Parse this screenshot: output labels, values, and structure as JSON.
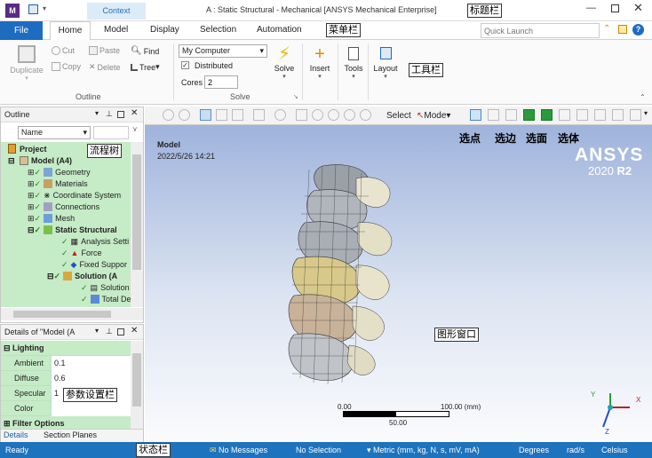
{
  "titlebar": {
    "context_tab": "Context",
    "title": "A : Static Structural - Mechanical [ANSYS Mechanical Enterprise]",
    "annotation": "标题栏"
  },
  "menubar": {
    "file": "File",
    "tabs": [
      "Home",
      "Model",
      "Display",
      "Selection",
      "Automation"
    ],
    "annotation": "菜单栏",
    "quick_launch_placeholder": "Quick Launch"
  },
  "ribbon": {
    "duplicate": "Duplicate",
    "cut": "Cut",
    "copy": "Copy",
    "paste": "Paste",
    "delete": "Delete",
    "find": "Find",
    "tree": "Tree",
    "outline_group": "Outline",
    "solver_target": "My Computer",
    "distributed": "Distributed",
    "cores_label": "Cores",
    "cores_value": "2",
    "solve": "Solve",
    "solve_group": "Solve",
    "insert": "Insert",
    "tools": "Tools",
    "layout": "Layout",
    "annotation": "工具栏"
  },
  "outline": {
    "title": "Outline",
    "name_filter": "Name",
    "annotation": "流程树",
    "items": [
      "Project",
      "Model (A4)",
      "Geometry",
      "Materials",
      "Coordinate System",
      "Connections",
      "Mesh",
      "Static Structural",
      "Analysis Setti",
      "Force",
      "Fixed Suppor",
      "Solution (A",
      "Solution",
      "Total De"
    ]
  },
  "details": {
    "title": "Details of \"Model (A",
    "group": "Lighting",
    "rows": [
      {
        "label": "Ambient",
        "value": "0.1"
      },
      {
        "label": "Diffuse",
        "value": "0.6"
      },
      {
        "label": "Specular",
        "value": "1"
      },
      {
        "label": "Color",
        "value": ""
      }
    ],
    "next_group": "Filter Options",
    "annotation": "参数设置栏",
    "tabs": [
      "Details",
      "Section Planes"
    ]
  },
  "graphics_toolbar": {
    "select": "Select",
    "mode": "Mode",
    "select_labels": [
      "选点",
      "选边",
      "选面",
      "选体"
    ]
  },
  "viewport": {
    "model_label": "Model",
    "timestamp": "2022/5/26 14:21",
    "brand": "ANSYS",
    "version_prefix": "2020",
    "version_suffix": "R2",
    "annotation": "图形窗口",
    "scale_min": "0.00",
    "scale_max": "100.00 (mm)",
    "scale_mid": "50.00",
    "axis_x": "X",
    "axis_y": "Y",
    "axis_z": "Z"
  },
  "statusbar": {
    "ready": "Ready",
    "annotation": "状态栏",
    "messages": "No Messages",
    "selection": "No Selection",
    "units": "Metric (mm, kg, N, s, mV, mA)",
    "angle": "Degrees",
    "rate": "rad/s",
    "temperature": "Celsius"
  },
  "colors": {
    "accent": "#1565c0",
    "tree_bg": "#c6ebc7",
    "statusbar": "#1e73be"
  }
}
